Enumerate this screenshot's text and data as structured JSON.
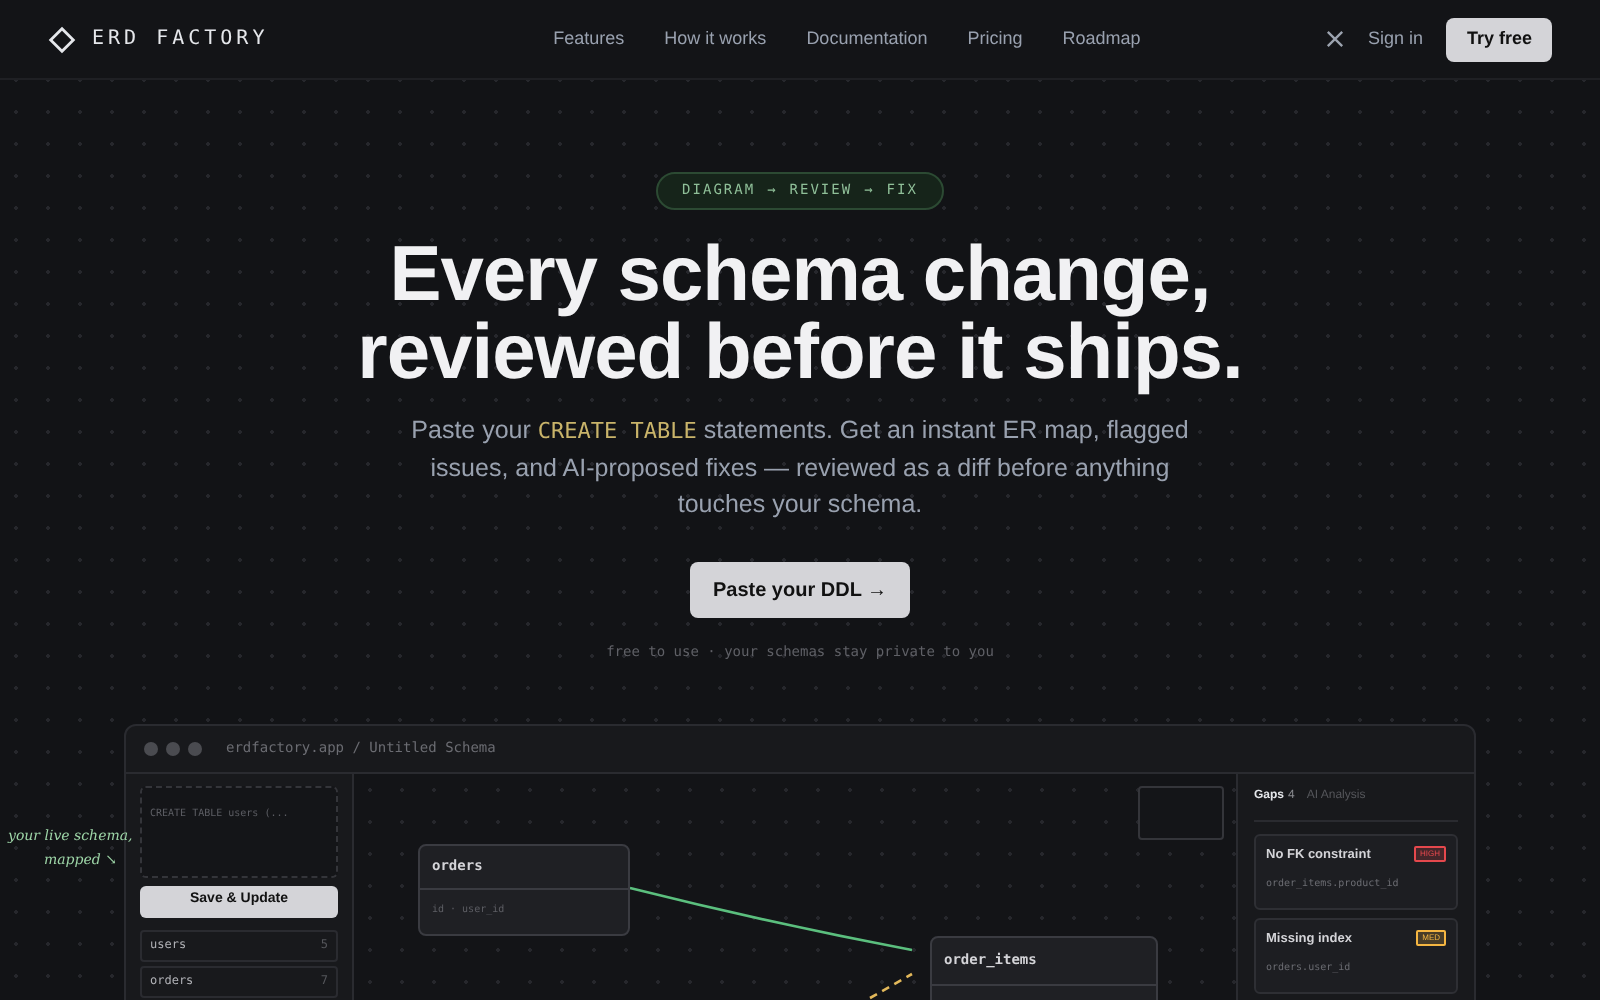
{
  "brand": "ERD FACTORY",
  "nav": [
    "Features",
    "How it works",
    "Documentation",
    "Pricing",
    "Roadmap"
  ],
  "sign_in": "Sign in",
  "try_free": "Try free",
  "badge": [
    "DIAGRAM",
    "→",
    "REVIEW",
    "→",
    "FIX"
  ],
  "title": [
    "Every schema change,",
    "reviewed before it ships."
  ],
  "intro": [
    {
      "kind": "plain",
      "text": "Paste your "
    },
    {
      "kind": "code",
      "text": "CREATE TABLE"
    },
    {
      "kind": "plain",
      "text": " statements. Get an instant ER map, flagged issues, and AI-proposed fixes — reviewed as a diff before anything touches your schema."
    }
  ],
  "cta": "Paste your DDL →",
  "note": "free to use · your schemas stay private to you",
  "app": {
    "address": "erdfactory.app / Untitled Schema",
    "editor_text": "CREATE TABLE users (...",
    "save": "Save & Update",
    "tables": [
      {
        "name": "users",
        "count": "5"
      },
      {
        "name": "orders",
        "count": "7"
      }
    ],
    "nodes": [
      {
        "name": "orders",
        "fields": "id · user_id"
      },
      {
        "name": "order_items"
      }
    ],
    "tabs": [
      {
        "label": "Gaps",
        "count": "4",
        "selected": true
      },
      {
        "label": "AI Analysis",
        "selected": false
      }
    ],
    "issues": [
      {
        "title": "No FK constraint",
        "severity": "HIGH",
        "color": "#e5484d",
        "column": "order_items.product_id"
      },
      {
        "title": "Missing index",
        "severity": "MED",
        "color": "#f5b642",
        "column": "orders.user_id"
      }
    ]
  },
  "annotation": [
    "your live schema,",
    "mapped ↘"
  ]
}
